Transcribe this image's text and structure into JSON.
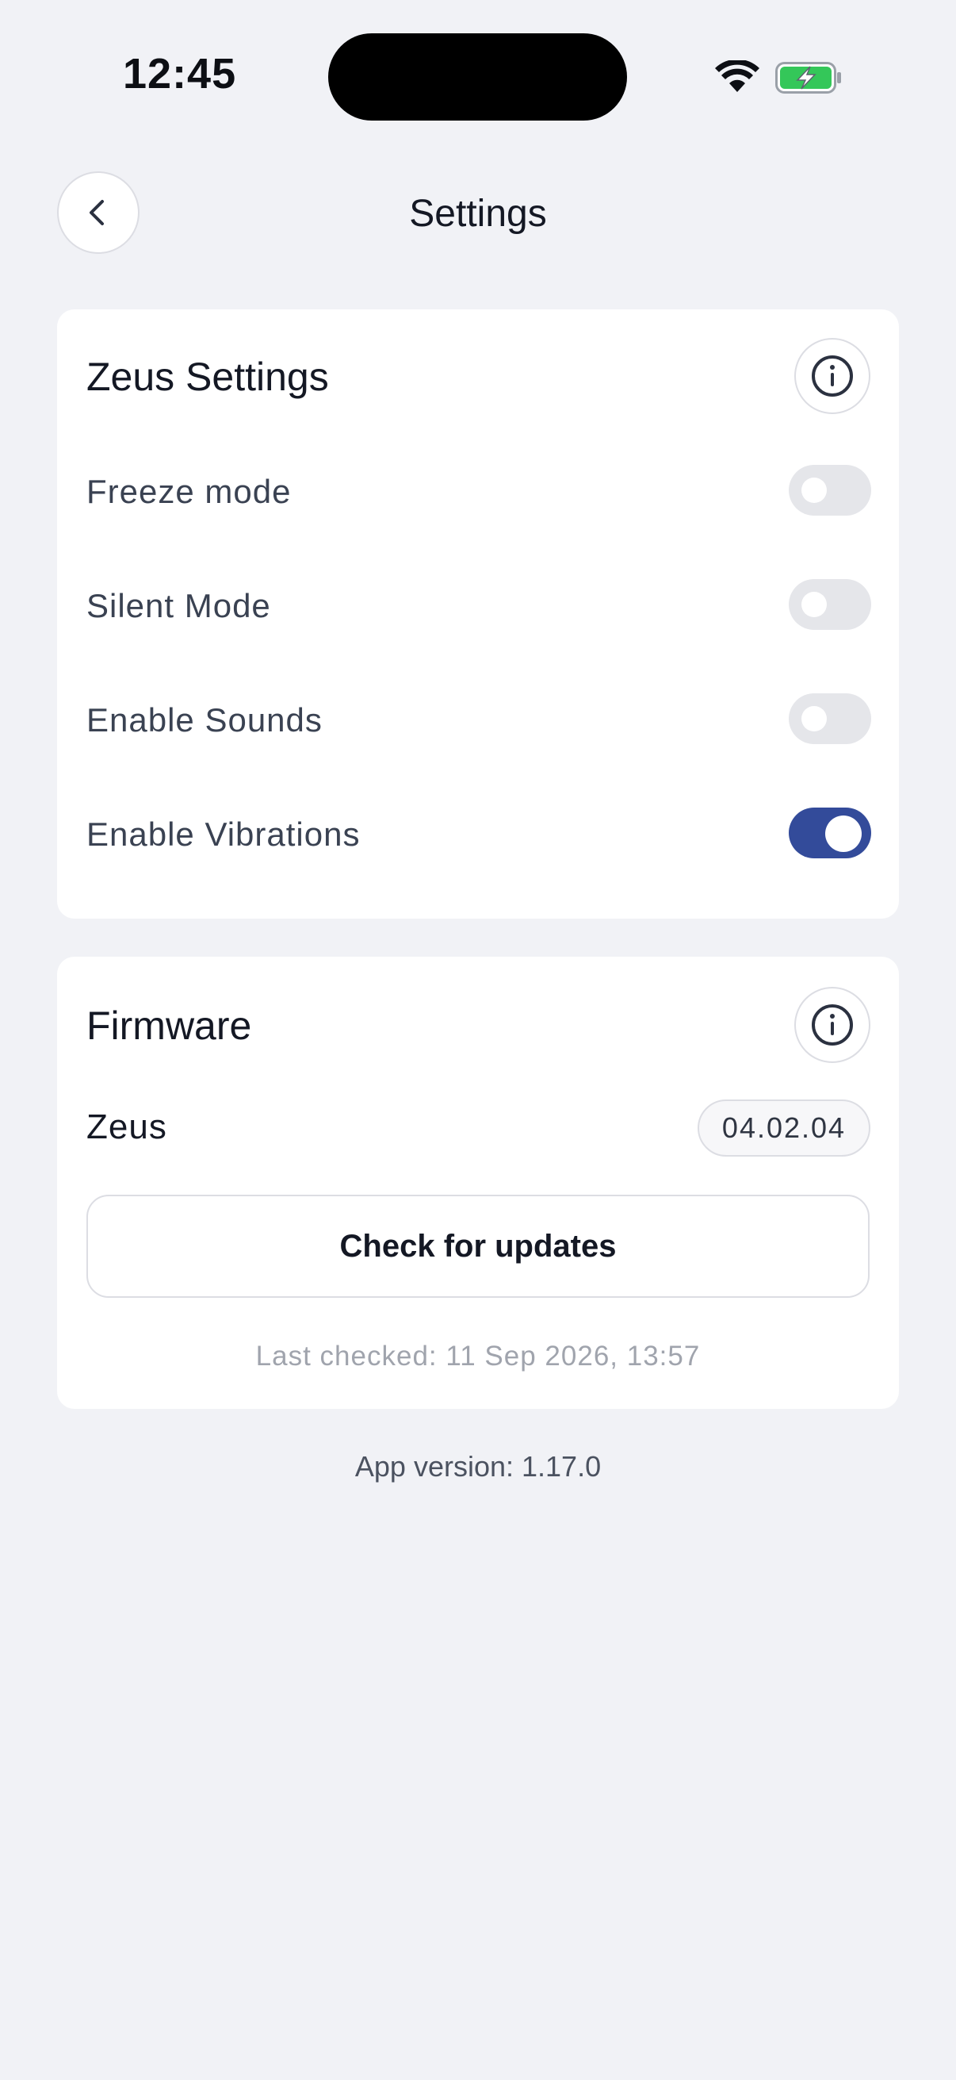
{
  "status_bar": {
    "time": "12:45",
    "wifi_icon": "wifi-icon",
    "battery_icon": "battery-charging-icon",
    "battery_color": "#34c759"
  },
  "header": {
    "title": "Settings",
    "back_icon": "chevron-left-icon"
  },
  "zeus_settings": {
    "title": "Zeus Settings",
    "info_icon": "info-icon",
    "toggles": [
      {
        "label": "Freeze mode",
        "on": false
      },
      {
        "label": "Silent Mode",
        "on": false
      },
      {
        "label": "Enable Sounds",
        "on": false
      },
      {
        "label": "Enable Vibrations",
        "on": true
      }
    ]
  },
  "firmware": {
    "title": "Firmware",
    "info_icon": "info-icon",
    "device_label": "Zeus",
    "version": "04.02.04",
    "check_button": "Check for updates",
    "last_checked": "Last checked: 11 Sep 2026, 13:57"
  },
  "footer": {
    "app_version": "App version: 1.17.0"
  },
  "colors": {
    "background": "#f1f2f6",
    "accent": "#334b9a",
    "toggle_off": "#e5e6ea"
  }
}
